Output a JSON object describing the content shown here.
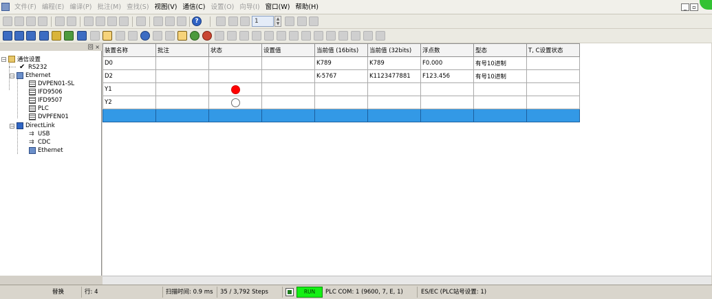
{
  "menu": [
    "文件(F)",
    "编程(E)",
    "编译(P)",
    "批注(M)",
    "查找(S)",
    "视图(V)",
    "通信(C)",
    "设置(O)",
    "向导(I)",
    "窗口(W)",
    "帮助(H)"
  ],
  "menu_disabled": [
    true,
    true,
    true,
    true,
    true,
    false,
    false,
    true,
    true,
    false,
    false
  ],
  "window_controls": [
    "_",
    "▫",
    "×"
  ],
  "toolbar": {
    "zoom_value": "1"
  },
  "tree": {
    "panel_buttons": "回 ×",
    "root": "通信设置",
    "rs232": "RS232",
    "ethernet": "Ethernet",
    "ethernet_children": [
      "DVPEN01-SL",
      "IFD9506",
      "IFD9507",
      "PLC",
      "DVPFEN01"
    ],
    "directlink": "DirectLink",
    "directlink_children": [
      "USB",
      "CDC",
      "Ethernet"
    ]
  },
  "table": {
    "columns": [
      "装置名称",
      "批注",
      "状态",
      "设置值",
      "当前值 (16bits)",
      "当前值 (32bits)",
      "浮点数",
      "型态",
      "T, C设置状态"
    ],
    "rows": [
      {
        "name": "D0",
        "comment": "",
        "state": "",
        "set": "",
        "v16": "K789",
        "v32": "K789",
        "float": "F0.000",
        "type": "有号10进制",
        "tc": ""
      },
      {
        "name": "D2",
        "comment": "",
        "state": "",
        "set": "",
        "v16": "K-5767",
        "v32": "K1123477881",
        "float": "F123.456",
        "type": "有号10进制",
        "tc": ""
      },
      {
        "name": "Y1",
        "comment": "",
        "state": "on",
        "set": "",
        "v16": "",
        "v32": "",
        "float": "",
        "type": "",
        "tc": ""
      },
      {
        "name": "Y2",
        "comment": "",
        "state": "off",
        "set": "",
        "v16": "",
        "v32": "",
        "float": "",
        "type": "",
        "tc": ""
      },
      {
        "name": "",
        "comment": "",
        "state": "",
        "set": "",
        "v16": "",
        "v32": "",
        "float": "",
        "type": "",
        "tc": ""
      }
    ],
    "selected_row": 4,
    "status_colors": {
      "on": "#ff0000",
      "off": "#ffffff",
      "selection": "#3399e6"
    }
  },
  "status": {
    "mode": "替换",
    "line": "行: 4",
    "scan": "扫描时间: 0.9 ms",
    "steps": "35 / 3,792 Steps",
    "run": "RUN",
    "plc_com": "PLC COM: 1 (9600, 7, E, 1)",
    "station": "ES/EC (PLC站号设置: 1)",
    "run_color": "#14f014"
  }
}
